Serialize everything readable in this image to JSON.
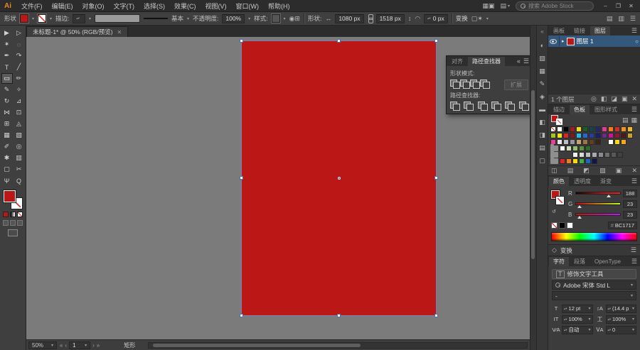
{
  "titlebar": {
    "logo": "Ai",
    "menus": [
      "文件(F)",
      "编辑(E)",
      "对象(O)",
      "文字(T)",
      "选择(S)",
      "效果(C)",
      "视图(V)",
      "窗口(W)",
      "帮助(H)"
    ],
    "icons": [
      {
        "name": "arrange-documents-icon",
        "glyph": "▦"
      },
      {
        "name": "gpu-performance-icon",
        "glyph": "▣"
      }
    ],
    "workspace_glyph": "▤",
    "search_placeholder": "搜索 Adobe Stock",
    "win_min": "–",
    "win_max": "❐",
    "win_close": "✕"
  },
  "glyphs": {
    "chevron": "▾",
    "menu": "☰",
    "collapse": "«"
  },
  "controlbar": {
    "object_label": "形状",
    "stroke_label": "描边:",
    "stroke_value": "",
    "brush_style": "基本",
    "opacity_label": "不透明度:",
    "opacity_value": "100%",
    "style_label": "样式:",
    "shape_label": "形状:",
    "w_value": "1080 px",
    "h_value": "1518 px",
    "corner_glyph": "◠",
    "corner_value": "0 px",
    "transform_label": "变换",
    "icons_mid": [
      {
        "name": "recolor-artwork-icon",
        "glyph": "◉"
      },
      {
        "name": "align-options-icon",
        "glyph": "⊞"
      }
    ],
    "icons_after": [
      {
        "name": "isolate-object-icon",
        "glyph": "▢"
      },
      {
        "name": "select-similar-icon",
        "glyph": "✶"
      }
    ],
    "icons_right": [
      {
        "name": "dock-arrange-icon",
        "glyph": "▤"
      },
      {
        "name": "dock-columns-icon",
        "glyph": "▥"
      },
      {
        "name": "control-panel-menu-icon",
        "glyph": "☰"
      }
    ]
  },
  "doc_tab": {
    "title": "未标题-1* @ 50% (RGB/预览)",
    "close": "✕"
  },
  "tools": [
    {
      "name": "selection-tool",
      "glyph": "▶"
    },
    {
      "name": "direct-selection-tool",
      "glyph": "▷"
    },
    {
      "name": "magic-wand-tool",
      "glyph": "✶"
    },
    {
      "name": "lasso-tool",
      "glyph": "◌"
    },
    {
      "name": "pen-tool",
      "glyph": "✒"
    },
    {
      "name": "curvature-tool",
      "glyph": "↷"
    },
    {
      "name": "type-tool",
      "glyph": "T"
    },
    {
      "name": "line-segment-tool",
      "glyph": "╱"
    },
    {
      "name": "rectangle-tool",
      "glyph": "▭",
      "active": true
    },
    {
      "name": "paintbrush-tool",
      "glyph": "✏"
    },
    {
      "name": "pencil-tool",
      "glyph": "✎"
    },
    {
      "name": "shaper-tool",
      "glyph": "✧"
    },
    {
      "name": "rotate-tool",
      "glyph": "↻"
    },
    {
      "name": "scale-tool",
      "glyph": "⊿"
    },
    {
      "name": "width-tool",
      "glyph": "⋈"
    },
    {
      "name": "free-transform-tool",
      "glyph": "⊡"
    },
    {
      "name": "shape-builder-tool",
      "glyph": "⊞"
    },
    {
      "name": "perspective-grid-tool",
      "glyph": "◬"
    },
    {
      "name": "mesh-tool",
      "glyph": "▦"
    },
    {
      "name": "gradient-tool",
      "glyph": "▧"
    },
    {
      "name": "eyedropper-tool",
      "glyph": "✐"
    },
    {
      "name": "blend-tool",
      "glyph": "◎"
    },
    {
      "name": "symbol-sprayer-tool",
      "glyph": "✱"
    },
    {
      "name": "column-graph-tool",
      "glyph": "▥"
    },
    {
      "name": "artboard-tool",
      "glyph": "▢"
    },
    {
      "name": "slice-tool",
      "glyph": "✂"
    },
    {
      "name": "hand-tool",
      "glyph": "Ψ"
    },
    {
      "name": "zoom-tool",
      "glyph": "Q"
    }
  ],
  "pathfinder": {
    "tabs": [
      "对齐",
      "路径查找器"
    ],
    "shape_modes_label": "形状模式:",
    "expand_label": "扩展",
    "pathfinder_label": "路径查找器:",
    "shape_mode_icons": [
      {
        "name": "unite-icon"
      },
      {
        "name": "minus-front-icon"
      },
      {
        "name": "intersect-icon"
      },
      {
        "name": "exclude-icon"
      }
    ],
    "pathfinder_icons": [
      {
        "name": "divide-icon"
      },
      {
        "name": "trim-icon"
      },
      {
        "name": "merge-icon"
      },
      {
        "name": "crop-icon"
      },
      {
        "name": "outline-icon"
      },
      {
        "name": "minus-back-icon"
      }
    ]
  },
  "layers_panel": {
    "tabs": [
      "画板",
      "链接",
      "图层"
    ],
    "expand_glyph": "▸",
    "layer_name": "图层 1",
    "target_glyph": "○",
    "status": "1 个图层",
    "action_icons": [
      {
        "name": "locate-object-icon",
        "glyph": "◎"
      },
      {
        "name": "make-clip-mask-icon",
        "glyph": "◧"
      },
      {
        "name": "new-sublayer-icon",
        "glyph": "◪"
      },
      {
        "name": "new-layer-icon",
        "glyph": "▣"
      },
      {
        "name": "delete-layer-icon",
        "glyph": "✕"
      }
    ]
  },
  "swatches_panel": {
    "tabs": [
      "描边",
      "色板",
      "图形样式"
    ],
    "view_icons": [
      {
        "name": "list-view-icon",
        "glyph": "▤"
      },
      {
        "name": "grid-view-icon",
        "glyph": "▦"
      }
    ],
    "rows": [
      [
        "none",
        "#ffffff",
        "#000000",
        "#9e1d22",
        "#f8d90f",
        "#1c5c2e",
        "#14444c",
        "#1c2c6b",
        "#e23a8e",
        "#ef7c21",
        "#d62b28",
        "#ef9423",
        "#f2b722"
      ],
      [
        "#a8c41e",
        "#f4e31c",
        "#d8262b",
        "#7e1a1d",
        "#26b6ea",
        "#2a67c9",
        "#2b3a9e",
        "#1b1f63",
        "#6d2a8e",
        "#c9178f",
        "#8c1836",
        "#4a1a1c",
        "#caa02c"
      ],
      [
        "#ee3d96",
        "#e6e7e8",
        "#bcbec0",
        "#939598",
        "#c7a16b",
        "#9d7443",
        "#633f1d",
        "#3d2313",
        "",
        "#ffffff",
        "#f8d90f",
        "#f2a71e",
        ""
      ]
    ],
    "group_rows": [
      {
        "colors": [
          "#ffffff",
          "#cddfb8",
          "#94bd6f",
          "#5c9140",
          "#2f6b2a",
          "",
          "",
          "",
          "",
          "",
          ""
        ]
      },
      {
        "colors": [
          "",
          "",
          "#f1f1f2",
          "#d8d9da",
          "#bcbec0",
          "#a7a9ac",
          "#8a8c8e",
          "#6d6e70",
          "#58595b",
          "#414142",
          ""
        ]
      },
      {
        "colors": [
          "#d8262b",
          "#ef7c21",
          "#f8d90f",
          "#3fae49",
          "#1f66c1",
          "#14144c",
          "",
          "",
          "",
          "",
          ""
        ]
      }
    ],
    "footer_icons": [
      {
        "name": "swatch-libraries-icon",
        "glyph": "◫"
      },
      {
        "name": "swatch-kinds-icon",
        "glyph": "▤"
      },
      {
        "name": "swatch-options-icon",
        "glyph": "◩"
      },
      {
        "name": "new-color-group-icon",
        "glyph": "▧"
      },
      {
        "name": "new-swatch-icon",
        "glyph": "▣"
      },
      {
        "name": "delete-swatch-icon",
        "glyph": "✕"
      }
    ]
  },
  "color_panel": {
    "tabs": [
      "颜色",
      "透明度",
      "渐变"
    ],
    "channels": [
      {
        "label": "R",
        "value": "188",
        "pct": 74
      },
      {
        "label": "G",
        "value": "23",
        "pct": 9
      },
      {
        "label": "B",
        "value": "23",
        "pct": 9
      }
    ],
    "hex_label": "#",
    "hex": "BC1717",
    "swatch_black": "#000000",
    "swatch_white": "#ffffff"
  },
  "transform_bar": {
    "icon_glyph": "◇",
    "title": "变换"
  },
  "character_panel": {
    "tabs": [
      "字符",
      "段落",
      "OpenType"
    ],
    "touch_type_icon": "T",
    "touch_type_label": "修饰文字工具",
    "font_name": "Adobe 宋体 Std L",
    "font_style": "-",
    "fields": [
      {
        "name": "font-size-field",
        "icon": "T",
        "value": "12 pt"
      },
      {
        "name": "leading-field",
        "icon": "↕A",
        "value": "(14.4 p"
      },
      {
        "name": "vertical-scale-field",
        "icon": "IT",
        "value": "100%"
      },
      {
        "name": "horizontal-scale-field",
        "icon": "工",
        "value": "100%"
      },
      {
        "name": "kerning-field",
        "icon": "V⁄A",
        "value": "自动"
      },
      {
        "name": "tracking-field",
        "icon": "ⅤA",
        "value": "0"
      }
    ]
  },
  "statusbar": {
    "zoom": "50%",
    "nav_first": "«",
    "nav_prev": "‹",
    "artboard_num": "1",
    "nav_next": "›",
    "nav_last": "»",
    "tool_name": "矩形"
  },
  "canvas": {
    "rect_color": "#BC1717"
  },
  "dock_icons": [
    {
      "name": "appearance-panel-icon",
      "glyph": "◐"
    },
    {
      "name": "color-panel-icon",
      "glyph": "▧"
    },
    {
      "name": "swatches-panel-icon",
      "glyph": "▦"
    },
    {
      "name": "brushes-panel-icon",
      "glyph": "✎"
    },
    {
      "name": "symbols-panel-icon",
      "glyph": "◈"
    },
    {
      "name": "stroke-panel-icon",
      "glyph": "▬"
    },
    {
      "name": "gradient-panel-icon",
      "glyph": "◧"
    },
    {
      "name": "transparency-panel-icon",
      "glyph": "◨"
    },
    {
      "name": "graphic-styles-panel-icon",
      "glyph": "▤"
    },
    {
      "name": "artboards-panel-icon",
      "glyph": "▢"
    }
  ]
}
